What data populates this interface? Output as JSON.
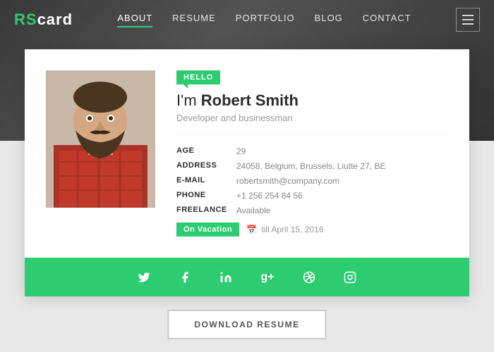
{
  "logo": {
    "rs": "RS",
    "card": "card"
  },
  "nav": {
    "items": [
      {
        "label": "ABOUT",
        "active": true
      },
      {
        "label": "RESUME",
        "active": false
      },
      {
        "label": "PORTFOLIO",
        "active": false
      },
      {
        "label": "BLOG",
        "active": false
      },
      {
        "label": "CONTACT",
        "active": false
      }
    ]
  },
  "profile": {
    "hello_badge": "HELLO",
    "intro": "I'm ",
    "name": "Robert Smith",
    "subtitle": "Developer and businessman",
    "details": [
      {
        "label": "AGE",
        "value": "29"
      },
      {
        "label": "ADDRESS",
        "value": "24058, Belgium, Brussels, Liutte 27, BE"
      },
      {
        "label": "E-MAIL",
        "value": "robertsmith@company.com"
      },
      {
        "label": "PHONE",
        "value": "+1 256 254 84 56"
      },
      {
        "label": "FREELANCE",
        "value": "Available"
      }
    ],
    "vacation_badge": "On Vacation",
    "vacation_text": "till April 15, 2016"
  },
  "social": {
    "icons": [
      {
        "name": "twitter",
        "symbol": "𝕏"
      },
      {
        "name": "facebook",
        "symbol": "f"
      },
      {
        "name": "linkedin",
        "symbol": "in"
      },
      {
        "name": "google-plus",
        "symbol": "g+"
      },
      {
        "name": "dribbble",
        "symbol": "◎"
      },
      {
        "name": "instagram",
        "symbol": "⊡"
      }
    ]
  },
  "download": {
    "label": "DOWNLOAD RESUME"
  },
  "colors": {
    "accent": "#2ecc71",
    "dark": "#2c2c2c",
    "muted": "#999"
  }
}
